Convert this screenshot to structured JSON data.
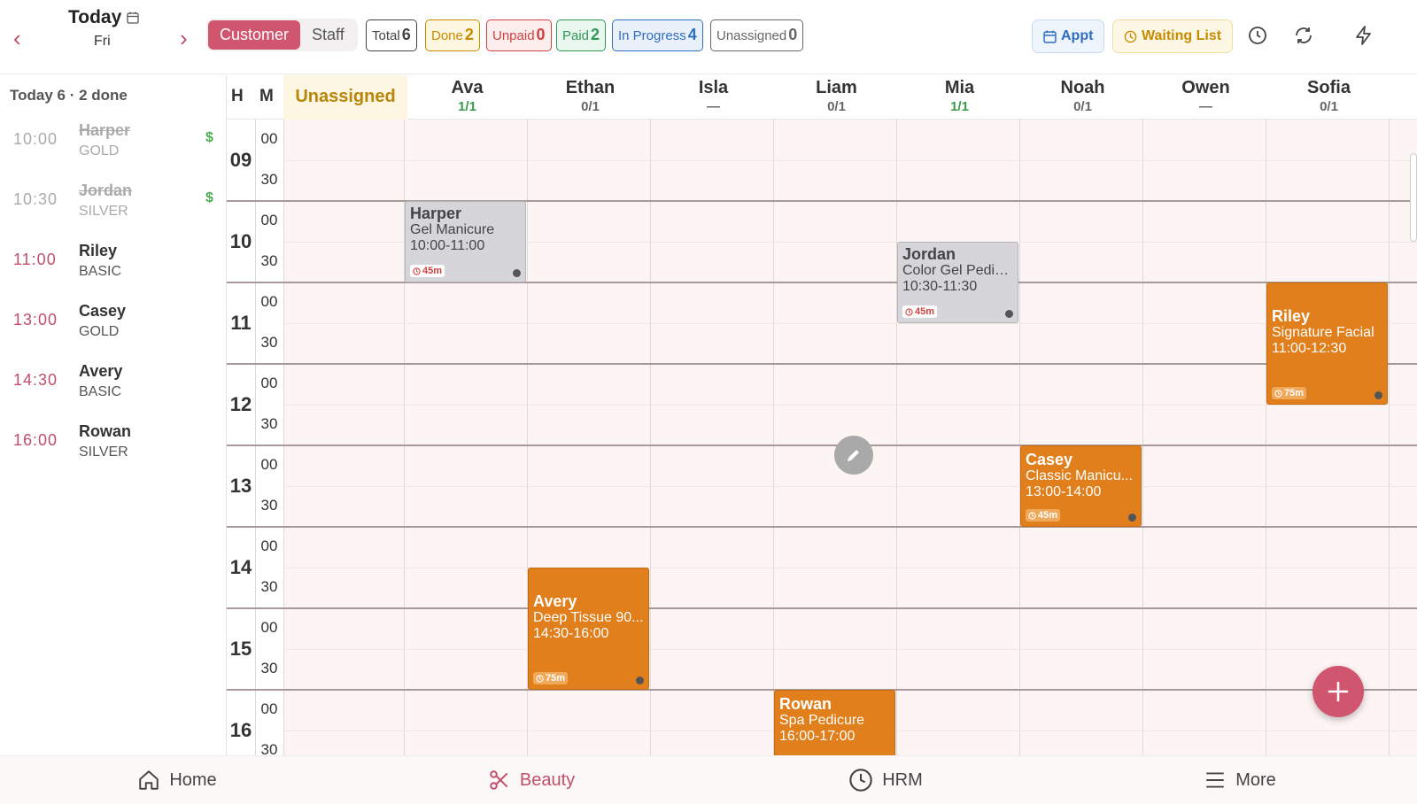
{
  "header": {
    "title": "Today",
    "weekday": "Fri",
    "prev_label": "‹",
    "next_label": "›",
    "segments": [
      "Customer",
      "Staff"
    ],
    "chips": [
      {
        "label": "Total",
        "value": "6",
        "color": "#444444"
      },
      {
        "label": "Done",
        "value": "2",
        "color": "#c98a00"
      },
      {
        "label": "Unpaid",
        "value": "0",
        "color": "#d04040"
      },
      {
        "label": "Paid",
        "value": "2",
        "color": "#2e9a55"
      },
      {
        "label": "In Progress",
        "value": "4",
        "color": "#2f6ec0"
      },
      {
        "label": "Unassigned",
        "value": "0",
        "color": "#666666"
      }
    ],
    "appt_label": "Appt",
    "waiting_label": "Waiting List"
  },
  "agenda": {
    "heading": "Today 6 · 2 done",
    "items": [
      {
        "time": "10:00",
        "name": "Harper",
        "tier": "GOLD",
        "done": true,
        "paid": "$"
      },
      {
        "time": "10:30",
        "name": "Jordan",
        "tier": "SILVER",
        "done": true,
        "paid": "$"
      },
      {
        "time": "11:00",
        "name": "Riley",
        "tier": "BASIC",
        "done": false,
        "paid": ""
      },
      {
        "time": "13:00",
        "name": "Casey",
        "tier": "GOLD",
        "done": false,
        "paid": ""
      },
      {
        "time": "14:30",
        "name": "Avery",
        "tier": "BASIC",
        "done": false,
        "paid": ""
      },
      {
        "time": "16:00",
        "name": "Rowan",
        "tier": "SILVER",
        "done": false,
        "paid": ""
      }
    ]
  },
  "grid": {
    "col_h": "H",
    "col_m": "M",
    "unassigned": "Unassigned",
    "staff": [
      {
        "name": "Ava",
        "count": "1/1",
        "ok": true
      },
      {
        "name": "Ethan",
        "count": "0/1",
        "ok": false
      },
      {
        "name": "Isla",
        "count": "—",
        "ok": false
      },
      {
        "name": "Liam",
        "count": "0/1",
        "ok": false
      },
      {
        "name": "Mia",
        "count": "1/1",
        "ok": true
      },
      {
        "name": "Noah",
        "count": "0/1",
        "ok": false
      },
      {
        "name": "Owen",
        "count": "—",
        "ok": false
      },
      {
        "name": "Sofia",
        "count": "0/1",
        "ok": false
      }
    ],
    "hours": [
      "09",
      "10",
      "11",
      "12",
      "13",
      "14",
      "15",
      "16"
    ],
    "minutes": [
      "00",
      "30"
    ]
  },
  "appointments": [
    {
      "name": "Harper",
      "service": "Gel Manicure",
      "time": "10:00-11:00",
      "duration": "45m",
      "staff": 0,
      "status": "done"
    },
    {
      "name": "Jordan",
      "service": "Color Gel Pedic...",
      "time": "10:30-11:30",
      "duration": "45m",
      "staff": 4,
      "status": "done"
    },
    {
      "name": "Riley",
      "service": "Signature Facial",
      "time": "11:00-12:30",
      "duration": "75m",
      "staff": 7,
      "status": "progress"
    },
    {
      "name": "Casey",
      "service": "Classic Manicu...",
      "time": "13:00-14:00",
      "duration": "45m",
      "staff": 5,
      "status": "progress"
    },
    {
      "name": "Avery",
      "service": "Deep Tissue 90...",
      "time": "14:30-16:00",
      "duration": "75m",
      "staff": 1,
      "status": "progress"
    },
    {
      "name": "Rowan",
      "service": "Spa Pedicure",
      "time": "16:00-17:00",
      "duration": "",
      "staff": 3,
      "status": "progress"
    }
  ],
  "bottom_nav": [
    {
      "label": "Home",
      "icon": "home-icon",
      "active": false
    },
    {
      "label": "Beauty",
      "icon": "scissors-icon",
      "active": true
    },
    {
      "label": "HRM",
      "icon": "clock-icon",
      "active": false
    },
    {
      "label": "More",
      "icon": "menu-icon",
      "active": false
    }
  ]
}
